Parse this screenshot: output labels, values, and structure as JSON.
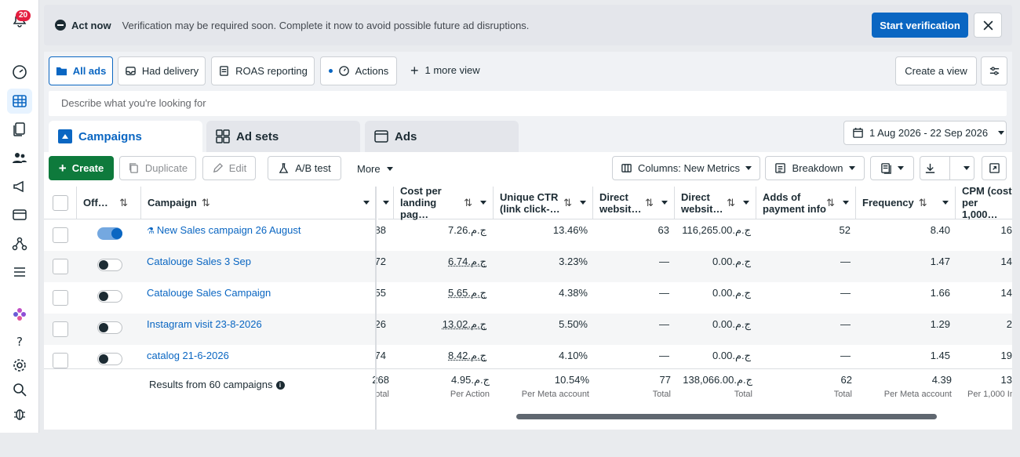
{
  "notifications": {
    "count": "20"
  },
  "banner": {
    "title": "Act now",
    "message": "Verification may be required soon. Complete it now to avoid possible future ad disruptions.",
    "button": "Start verification"
  },
  "views": {
    "all_ads": "All ads",
    "had_delivery": "Had delivery",
    "roas": "ROAS reporting",
    "actions": "Actions",
    "more_view": "1 more view",
    "create_view": "Create a view"
  },
  "search": {
    "placeholder": "Describe what you're looking for"
  },
  "tabs": [
    {
      "label": "Campaigns"
    },
    {
      "label": "Ad sets"
    },
    {
      "label": "Ads"
    }
  ],
  "date_range": "1 Aug 2026 - 22 Sep 2026",
  "toolbar": {
    "create": "Create",
    "duplicate": "Duplicate",
    "edit": "Edit",
    "ab_test": "A/B test",
    "more": "More",
    "columns": "Columns: New Metrics",
    "breakdown": "Breakdown"
  },
  "table": {
    "headers": {
      "off": "Off…",
      "campaign": "Campaign",
      "cost_lp": "Cost per landing pag…",
      "ctr": "Unique CTR (link click-…",
      "direct1": "Direct websit…",
      "direct2": "Direct websit…",
      "adds_payment": "Adds of payment info",
      "frequency": "Frequency",
      "cpm": "CPM (cost per 1,000…"
    },
    "rows": [
      {
        "name": "New Sales campaign 26 August",
        "partial": "88",
        "cost": "7.26.ج.م",
        "ctr": "13.46%",
        "d1": "63",
        "d2": "116,265.00.ج.م",
        "adds": "52",
        "freq": "8.40",
        "cpm": "16"
      },
      {
        "name": "Catalouge Sales 3 Sep",
        "partial": "72",
        "cost": "6.74.ج.م",
        "ctr": "3.23%",
        "d1": "—",
        "d2": "0.00.ج.م",
        "adds": "—",
        "freq": "1.47",
        "cpm": "14"
      },
      {
        "name": "Catalouge Sales Campaign",
        "partial": "55",
        "cost": "5.65.ج.م",
        "ctr": "4.38%",
        "d1": "—",
        "d2": "0.00.ج.م",
        "adds": "—",
        "freq": "1.66",
        "cpm": "14"
      },
      {
        "name": "Instagram visit 23-8-2026",
        "partial": "26",
        "cost": "13.02.ج.م",
        "ctr": "5.50%",
        "d1": "—",
        "d2": "0.00.ج.م",
        "adds": "—",
        "freq": "1.29",
        "cpm": "2"
      },
      {
        "name": "catalog 21-6-2026",
        "partial": "74",
        "cost": "8.42.ج.م",
        "ctr": "4.10%",
        "d1": "—",
        "d2": "0.00.ج.م",
        "adds": "—",
        "freq": "1.45",
        "cpm": "19"
      }
    ],
    "summary": {
      "label": "Results from 60 campaigns",
      "partial": "268",
      "partial_sub": "otal",
      "cost": "4.95.ج.م",
      "cost_sub": "Per Action",
      "ctr": "10.54%",
      "ctr_sub": "Per Meta account",
      "d1": "77",
      "d1_sub": "Total",
      "d2": "138,066.00.ج.م",
      "d2_sub": "Total",
      "adds": "62",
      "adds_sub": "Total",
      "freq": "4.39",
      "freq_sub": "Per Meta account",
      "cpm": "13",
      "cpm_sub": "Per 1,000 Im"
    }
  }
}
